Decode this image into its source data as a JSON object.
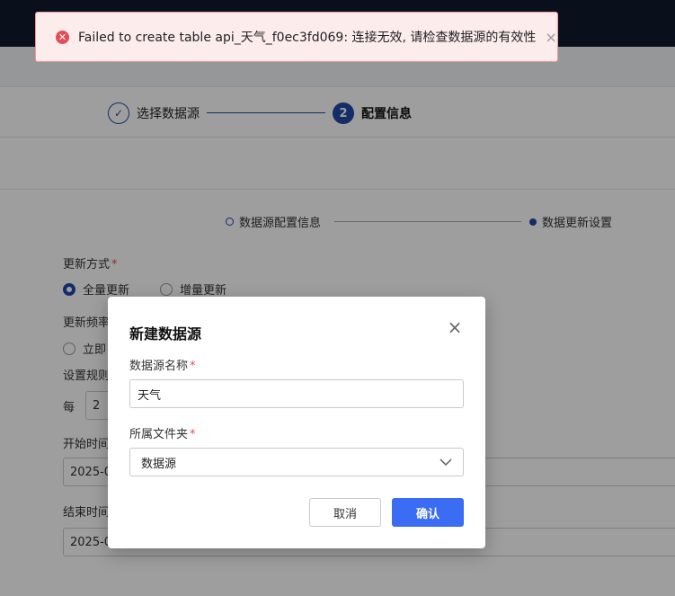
{
  "steps": {
    "step1_label": "选择数据源",
    "step2_number": "2",
    "step2_label": "配置信息"
  },
  "substeps": {
    "sub1_label": "数据源配置信息",
    "sub2_label": "数据更新设置"
  },
  "form": {
    "update_mode_label": "更新方式",
    "mode_full": "全量更新",
    "mode_incremental": "增量更新",
    "update_freq_label": "更新频率",
    "freq_now": "立即",
    "rule_label": "设置规则",
    "every_label": "每",
    "every_value": "2",
    "start_time_label": "开始时间",
    "start_time_value": "2025-0",
    "end_time_label": "结束时间",
    "end_time_value": "2025-0"
  },
  "toast": {
    "icon": "error-icon",
    "message": "Failed to create table api_天气_f0ec3fd069: 连接无效, 请检查数据源的有效性",
    "close": "×"
  },
  "dialog": {
    "title": "新建数据源",
    "close": "×",
    "name_label": "数据源名称",
    "name_value": "天气",
    "folder_label": "所属文件夹",
    "folder_value": "数据源",
    "cancel_label": "取消",
    "confirm_label": "确认",
    "required_mark": "*"
  },
  "colors": {
    "primary": "#1f4aa8",
    "confirm": "#3a6cf4",
    "error": "#e34d59"
  }
}
